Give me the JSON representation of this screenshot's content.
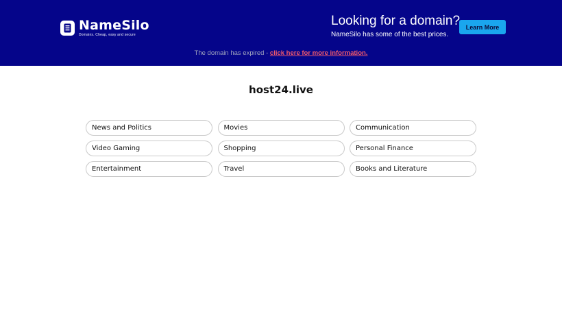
{
  "header": {
    "logo": {
      "name": "NameSilo",
      "tagline": "Domains. Cheap, easy and secure"
    },
    "promo": {
      "title": "Looking for a domain?",
      "subtitle": "NameSilo has some of the best prices."
    },
    "learn_more_label": "Learn More",
    "expired_text": "The domain has expired - ",
    "expired_link": "click here for more information.",
    "colors": {
      "background": "#05058a",
      "button": "#1aa6ee",
      "link": "#f0596b"
    }
  },
  "main": {
    "domain": "host24.live",
    "links": [
      "News and Politics",
      "Movies",
      "Communication",
      "Video Gaming",
      "Shopping",
      "Personal Finance",
      "Entertainment",
      "Travel",
      "Books and Literature"
    ]
  },
  "icons": {
    "logo": "document-icon"
  }
}
